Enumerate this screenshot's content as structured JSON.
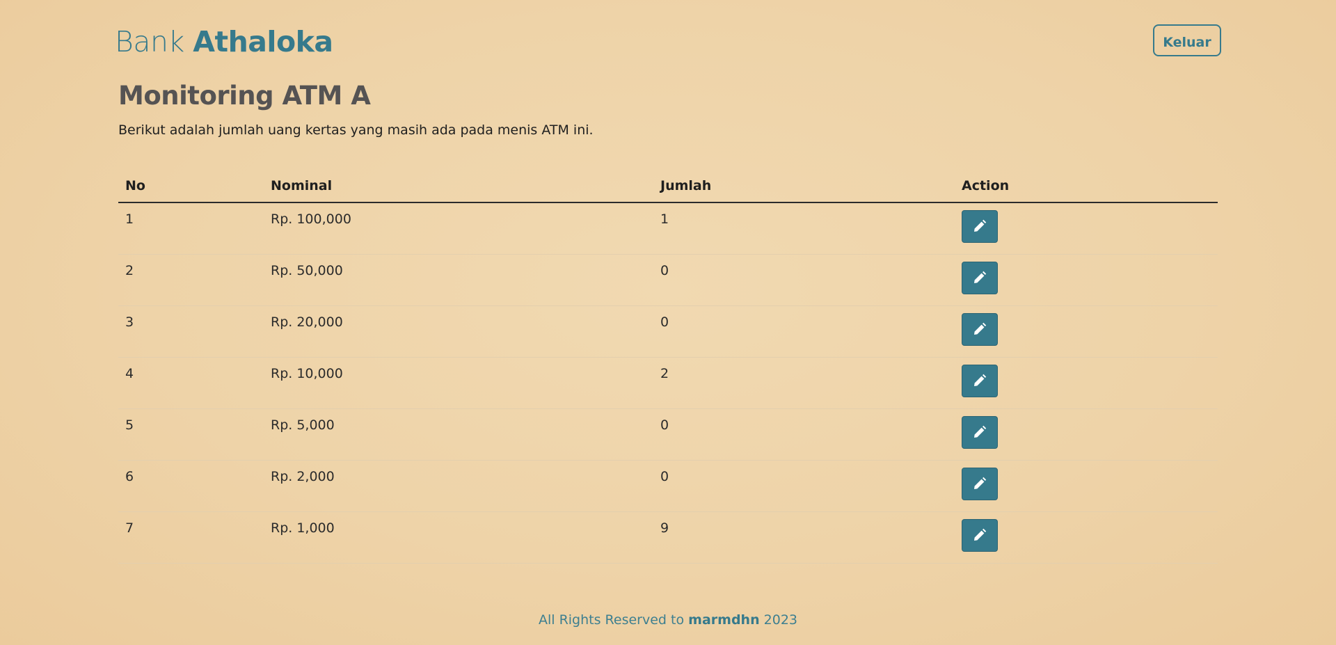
{
  "header": {
    "brand_light": "Bank",
    "brand_bold": "Athaloka",
    "logout_label": "Keluar"
  },
  "page": {
    "title": "Monitoring ATM A",
    "subtitle": "Berikut adalah jumlah uang kertas yang masih ada pada menis ATM ini."
  },
  "table": {
    "headers": [
      "No",
      "Nominal",
      "Jumlah",
      "Action"
    ],
    "rows": [
      {
        "no": "1",
        "nominal": "Rp. 100,000",
        "jumlah": "1"
      },
      {
        "no": "2",
        "nominal": "Rp. 50,000",
        "jumlah": "0"
      },
      {
        "no": "3",
        "nominal": "Rp. 20,000",
        "jumlah": "0"
      },
      {
        "no": "4",
        "nominal": "Rp. 10,000",
        "jumlah": "2"
      },
      {
        "no": "5",
        "nominal": "Rp. 5,000",
        "jumlah": "0"
      },
      {
        "no": "6",
        "nominal": "Rp. 2,000",
        "jumlah": "0"
      },
      {
        "no": "7",
        "nominal": "Rp. 1,000",
        "jumlah": "9"
      }
    ],
    "action_icon": "pencil-icon"
  },
  "footer": {
    "prefix": "All Rights Reserved to",
    "author": "marmdhn",
    "year": "2023"
  },
  "colors": {
    "accent": "#367a8c",
    "background": "#eed3a8",
    "title": "#555353"
  }
}
